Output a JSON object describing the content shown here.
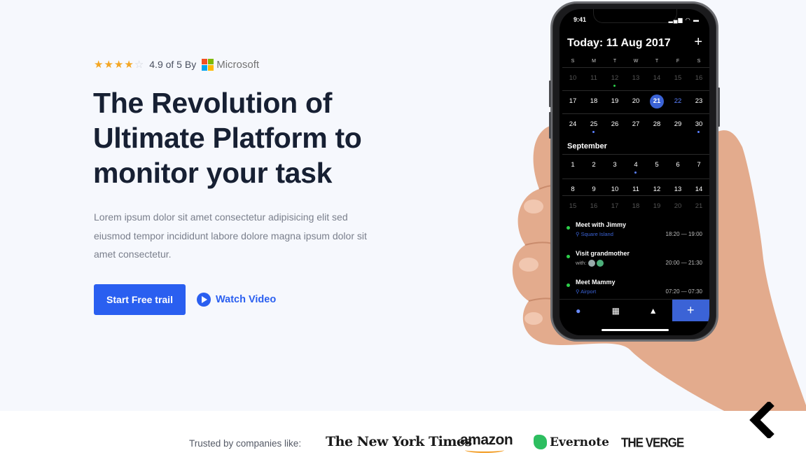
{
  "rating": {
    "stars_filled": 4,
    "stars_total": 5,
    "text": "4.9 of 5 By",
    "brand": "Microsoft"
  },
  "hero": {
    "headline_lines": [
      "The Revolution of",
      "Ultimate Platform to",
      "monitor your task"
    ],
    "description": "Lorem ipsum dolor sit amet consectetur adipisicing elit sed eiusmod tempor incididunt labore dolore magna ipsum dolor sit amet consectetur.",
    "primary_button": "Start Free trail",
    "secondary_link": "Watch Video"
  },
  "phone": {
    "status_time": "9:41",
    "title": "Today: 11 Aug 2017",
    "add_symbol": "+",
    "weekdays": [
      "S",
      "M",
      "T",
      "W",
      "T",
      "F",
      "S"
    ],
    "weeks": [
      [
        "10",
        "11",
        "12",
        "13",
        "14",
        "15",
        "16"
      ],
      [
        "17",
        "18",
        "19",
        "20",
        "21",
        "22",
        "23"
      ],
      [
        "24",
        "25",
        "26",
        "27",
        "28",
        "29",
        "30"
      ]
    ],
    "month_label": "September",
    "weeks_next": [
      [
        "1",
        "2",
        "3",
        "4",
        "5",
        "6",
        "7"
      ],
      [
        "8",
        "9",
        "10",
        "11",
        "12",
        "13",
        "14"
      ],
      [
        "15",
        "16",
        "17",
        "18",
        "19",
        "20",
        "21"
      ]
    ],
    "events": [
      {
        "title": "Meet with Jimmy",
        "sub": "Square Island",
        "time": "18:20 — 19:00"
      },
      {
        "title": "Visit grandmother",
        "sub": "with:",
        "time": "20:00 — 21:30"
      },
      {
        "title": "Meet Mammy",
        "sub": "Airport",
        "time": "07:20 — 07:30"
      }
    ],
    "tab_add": "+"
  },
  "trusted": {
    "label": "Trusted by companies like:",
    "logos": [
      "The New York Times",
      "amazon",
      "Evernote",
      "THE VERGE"
    ]
  },
  "colors": {
    "accent": "#2a5ff0",
    "heading": "#172033",
    "background": "#f6f8fd",
    "star": "#f4a623"
  }
}
